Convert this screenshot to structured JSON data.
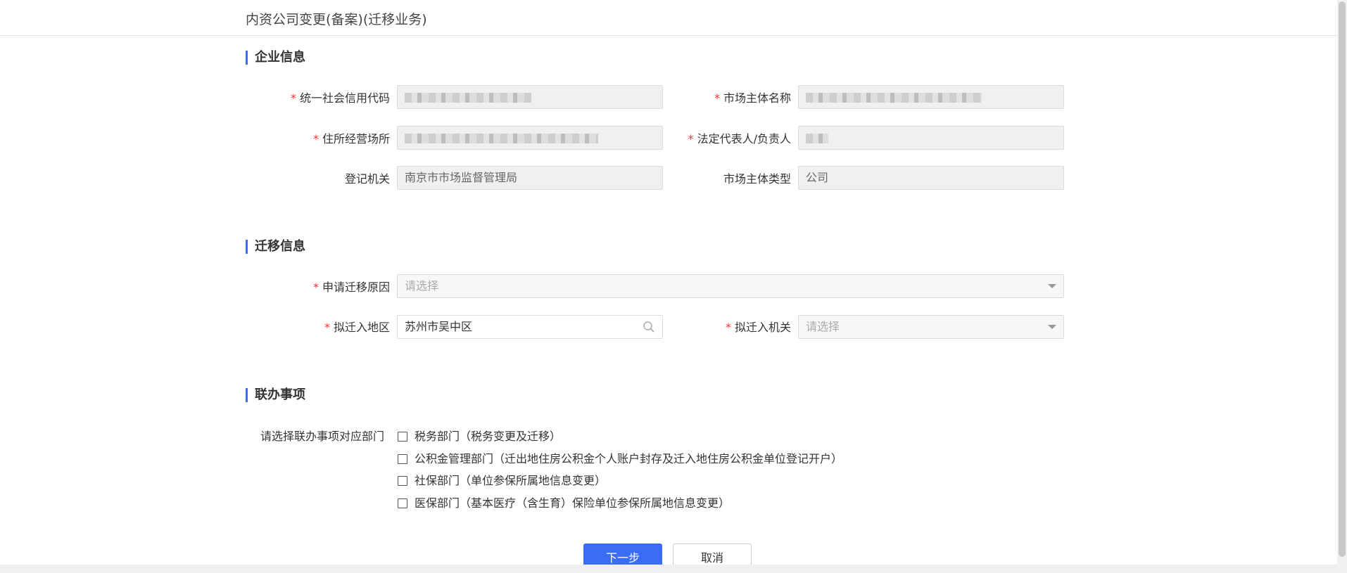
{
  "page": {
    "title": "内资公司变更(备案)(迁移业务)"
  },
  "enterprise": {
    "section_title": "企业信息",
    "credit_code": {
      "label": "统一社会信用代码",
      "value": ""
    },
    "entity_name": {
      "label": "市场主体名称",
      "value": ""
    },
    "address": {
      "label": "住所经营场所",
      "value": ""
    },
    "legal_rep": {
      "label": "法定代表人/负责人",
      "value": ""
    },
    "reg_authority": {
      "label": "登记机关",
      "value": "南京市市场监督管理局"
    },
    "entity_type": {
      "label": "市场主体类型",
      "value": "公司"
    },
    "required_mark": "*"
  },
  "migration": {
    "section_title": "迁移信息",
    "reason": {
      "label": "申请迁移原因",
      "placeholder": "请选择"
    },
    "region": {
      "label": "拟迁入地区",
      "value": "苏州市吴中区"
    },
    "authority": {
      "label": "拟迁入机关",
      "placeholder": "请选择"
    },
    "required_mark": "*"
  },
  "joint": {
    "section_title": "联办事项",
    "dept_label": "请选择联办事项对应部门",
    "options": [
      {
        "label": "税务部门（税务变更及迁移）",
        "checked": false
      },
      {
        "label": "公积金管理部门（迁出地住房公积金个人账户封存及迁入地住房公积金单位登记开户）",
        "checked": false
      },
      {
        "label": "社保部门（单位参保所属地信息变更）",
        "checked": false
      },
      {
        "label": "医保部门（基本医疗（含生育）保险单位参保所属地信息变更）",
        "checked": false
      }
    ]
  },
  "actions": {
    "next_label": "下一步",
    "cancel_label": "取消"
  },
  "colors": {
    "primary": "#3b6cf6",
    "required": "#e33333"
  }
}
